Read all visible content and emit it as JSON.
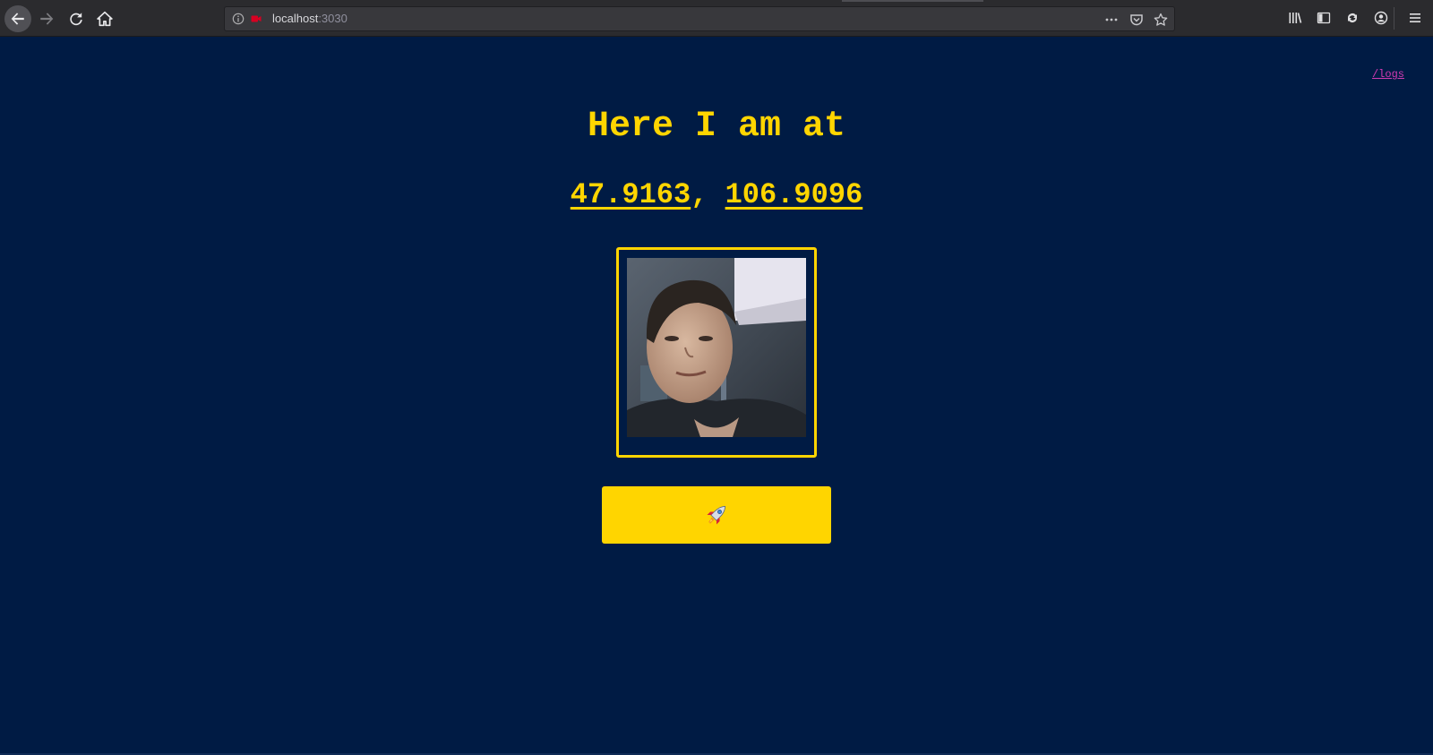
{
  "browser": {
    "url_host": "localhost",
    "url_port": ":3030",
    "icons": [
      "back-arrow-icon",
      "forward-arrow-icon",
      "reload-icon",
      "home-icon",
      "info-icon",
      "camera-blocked-icon",
      "more-dots-icon",
      "pocket-icon",
      "star-icon",
      "library-icon",
      "sidebar-icon",
      "sync-icon",
      "account-icon",
      "hamburger-menu-icon"
    ]
  },
  "page": {
    "logs_link": "/logs",
    "title": "Here I am at",
    "latitude": "47.9163",
    "separator": ", ",
    "longitude": "106.9096",
    "launch_button_icon": "rocket-icon"
  },
  "colors": {
    "background": "#001b44",
    "accent": "#ffd500",
    "link": "#d23ab3",
    "toolbar": "#2b2b2e"
  }
}
